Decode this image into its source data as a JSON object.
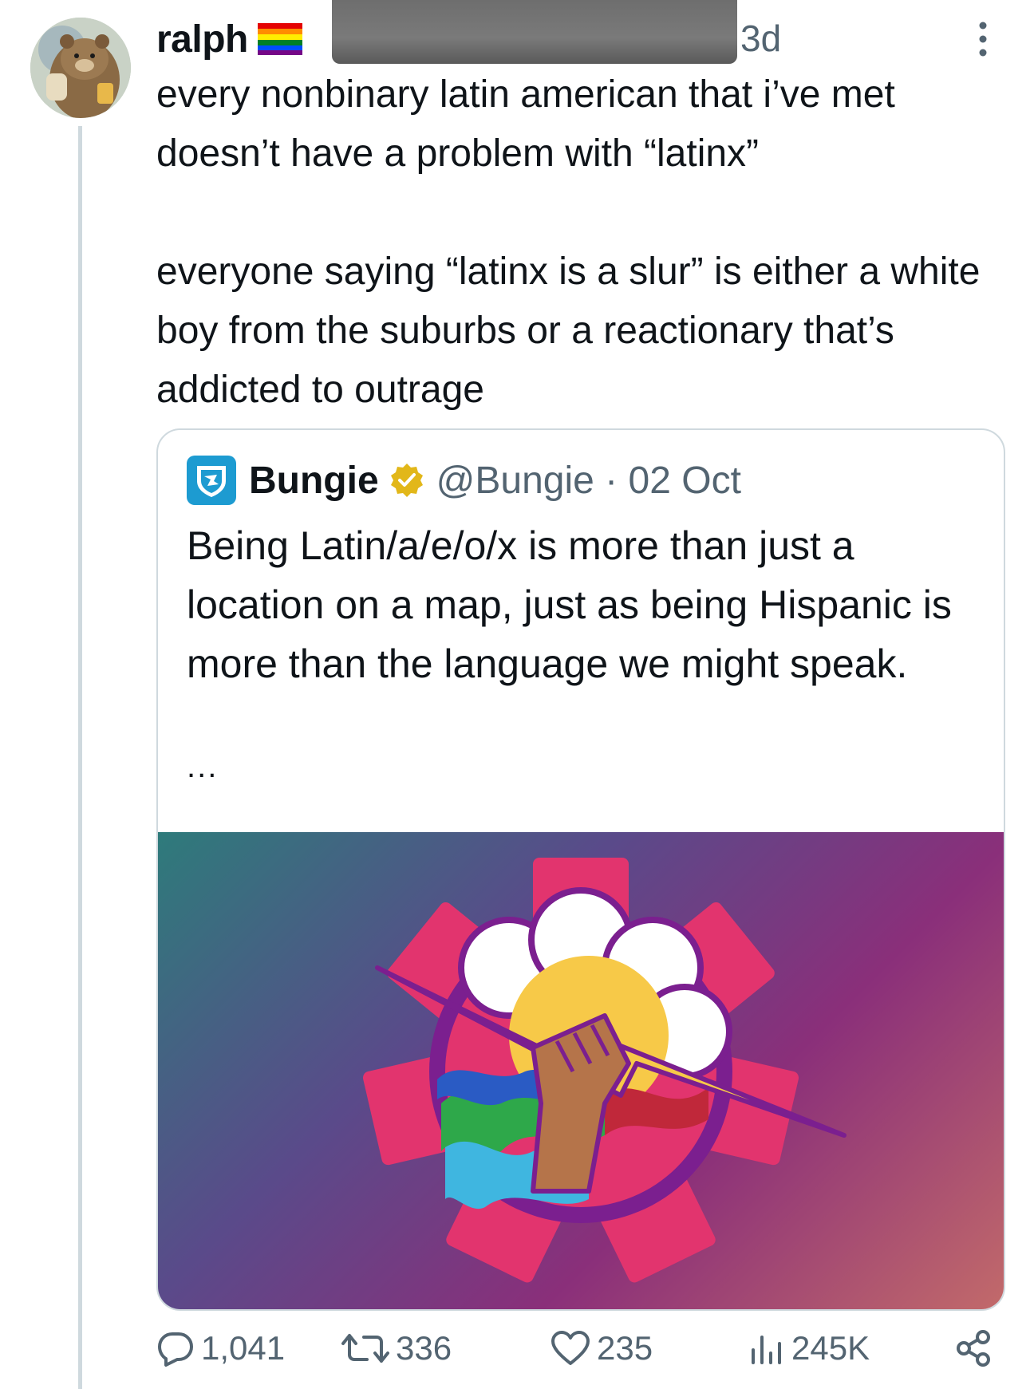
{
  "post": {
    "display_name": "ralph",
    "flag_icon": "rainbow-flag-icon",
    "timestamp": "3d",
    "text": "every nonbinary latin american that i’ve met doesn’t have a problem with “latinx”\n\neveryone saying “latinx is a slur” is either a white boy from the suburbs or a reactionary that’s addicted to outrage"
  },
  "quote": {
    "name": "Bungie",
    "handle_date": "@Bungie · 02 Oct",
    "text": "Being Latin/a/e/o/x is more than just a location on a map, just as being Hispanic is more than the language we might speak.",
    "ellipsis": "..."
  },
  "actions": {
    "replies": "1,041",
    "reposts": "336",
    "likes": "235",
    "views": "245K"
  },
  "colors": {
    "text_primary": "#0f1419",
    "text_secondary": "#536471",
    "border": "#cfd9de",
    "verified_gold": "#e2b719",
    "bungie_blue": "#1d9bd1"
  }
}
